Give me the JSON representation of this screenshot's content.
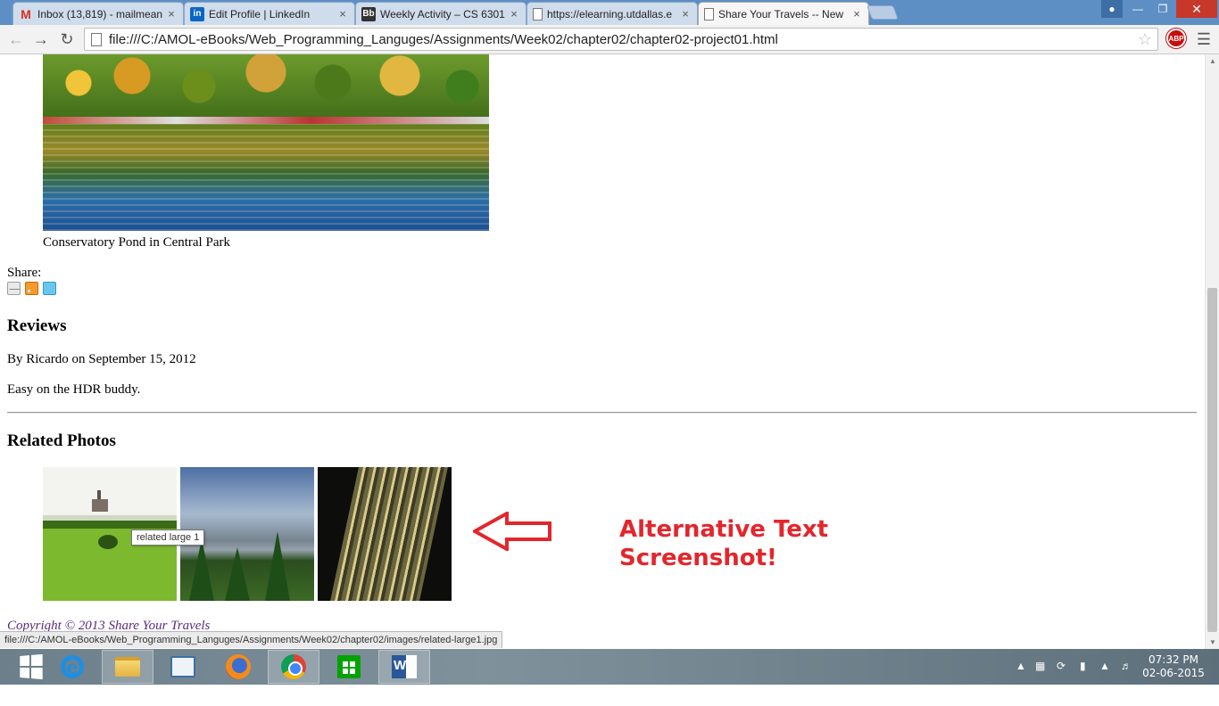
{
  "browser": {
    "tabs": [
      {
        "title": "Inbox (13,819) - mailmean",
        "icon": "gmail-icon"
      },
      {
        "title": "Edit Profile | LinkedIn",
        "icon": "linkedin-icon"
      },
      {
        "title": "Weekly Activity – CS 6301",
        "icon": "blackboard-icon"
      },
      {
        "title": "https://elearning.utdallas.e",
        "icon": "page-icon"
      },
      {
        "title": "Share Your Travels -- New",
        "icon": "page-icon",
        "active": true
      }
    ],
    "url": "file:///C:/AMOL-eBooks/Web_Programming_Languges/Assignments/Week02/chapter02/chapter02-project01.html",
    "extension_label": "ABP",
    "status_url": "file:///C:/AMOL-eBooks/Web_Programming_Languges/Assignments/Week02/chapter02/images/related-large1.jpg"
  },
  "page": {
    "hero_caption": "Conservatory Pond in Central Park",
    "share_label": "Share:",
    "reviews_heading": "Reviews",
    "review_byline": "By Ricardo on September 15, 2012",
    "review_text": "Easy on the HDR buddy.",
    "related_heading": "Related Photos",
    "tooltip": "related large 1",
    "copyright": "Copyright © 2013 Share Your Travels"
  },
  "annotation": {
    "line1": "Alternative Text",
    "line2": "Screenshot!",
    "color": "#e3262c"
  },
  "taskbar": {
    "apps": [
      "start",
      "internet-explorer",
      "file-explorer",
      "remote-desktop",
      "firefox",
      "chrome",
      "store",
      "word"
    ],
    "time": "07:32 PM",
    "date": "02-06-2015"
  }
}
